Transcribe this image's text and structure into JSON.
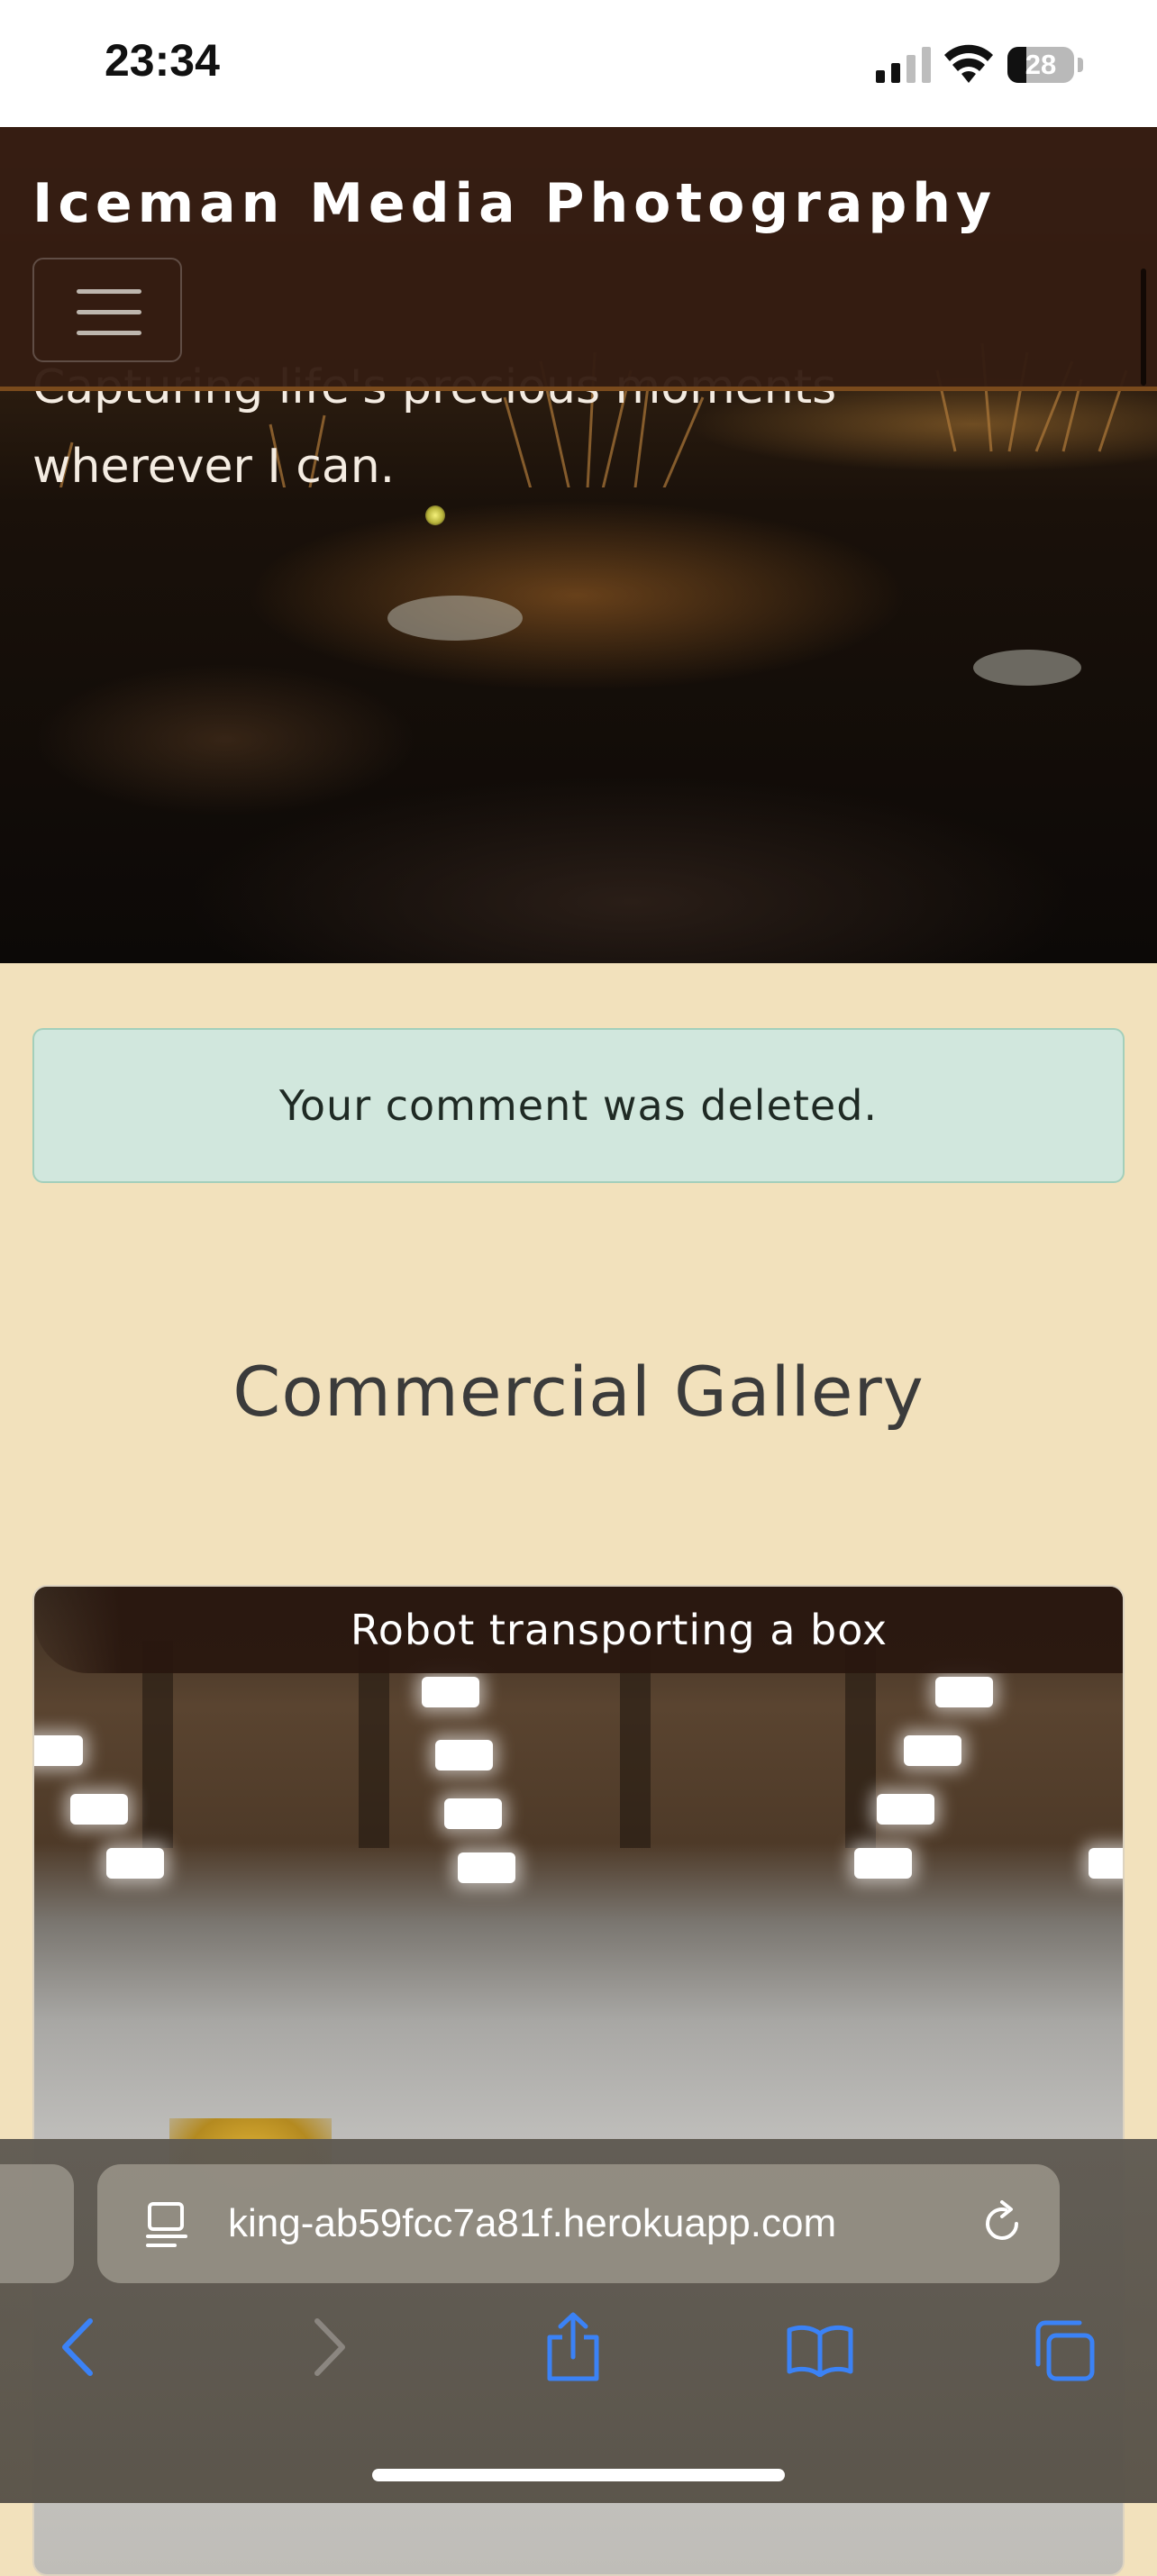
{
  "status_bar": {
    "time": "23:34",
    "battery": "28",
    "battery_level": 0.28
  },
  "site": {
    "brand": "Iceman Media Photography",
    "tagline": "Capturing life's precious moments wherever I can."
  },
  "alert": {
    "message": "Your comment was deleted."
  },
  "gallery": {
    "heading": "Commercial Gallery",
    "items": [
      {
        "caption": "Robot transporting a box"
      }
    ]
  },
  "browser": {
    "url": "king-ab59fcc7a81f.herokuapp.com",
    "icons": [
      "page-icon",
      "reload-icon",
      "back-icon",
      "forward-icon",
      "share-icon",
      "bookmarks-icon",
      "tabs-icon"
    ]
  },
  "colors": {
    "page_background": "#f2e1bc",
    "navbar": "#341c12",
    "alert_background": "#d1e7dd",
    "accent_blue": "#3b82f6"
  }
}
